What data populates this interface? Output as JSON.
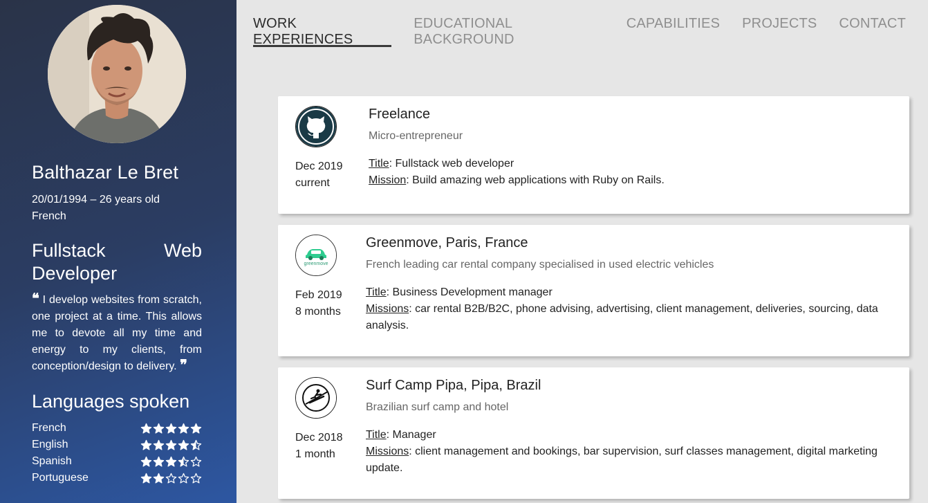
{
  "profile": {
    "name": "Balthazar Le Bret",
    "birth": "20/01/1994 – 26 years old",
    "nationality": "French",
    "role_word1": "Fullstack",
    "role_word2": "Web",
    "role_word3": "Developer",
    "quote": "I develop websites from scratch, one project at a time. This allows me to devote all my time and energy to my clients, from conception/design to delivery.",
    "quote_open": "❝",
    "quote_close": "❞"
  },
  "languages": {
    "title": "Languages spoken",
    "items": [
      {
        "name": "French",
        "rating": 5
      },
      {
        "name": "English",
        "rating": 4.5
      },
      {
        "name": "Spanish",
        "rating": 3.5
      },
      {
        "name": "Portuguese",
        "rating": 2
      }
    ]
  },
  "tabs": [
    {
      "label": "WORK EXPERIENCES",
      "active": true
    },
    {
      "label": "EDUCATIONAL BACKGROUND"
    },
    {
      "label": "CAPABILITIES"
    },
    {
      "label": "PROJECTS"
    },
    {
      "label": "CONTACT"
    }
  ],
  "experiences": [
    {
      "logo": "github-icon",
      "date_start": "Dec 2019",
      "duration": "current",
      "company": "Freelance",
      "subtitle": "Micro-entrepreneur",
      "title_label": "Title",
      "title_value": ": Fullstack web developer",
      "mission_label": "Mission",
      "mission_value": ": Build amazing web applications with Ruby on Rails."
    },
    {
      "logo": "greenmove-logo",
      "logo_text": "greenmove",
      "date_start": "Feb 2019",
      "duration": "8 months",
      "company": "Greenmove, Paris, France",
      "subtitle": "French leading car rental company specialised in used electric vehicles",
      "title_label": "Title",
      "title_value": ": Business Development manager",
      "mission_label": "Missions",
      "mission_value": ": car rental B2B/B2C, phone advising, advertising, client management, deliveries, sourcing, data analysis."
    },
    {
      "logo": "surfer-icon",
      "date_start": "Dec 2018",
      "duration": "1 month",
      "company": "Surf Camp Pipa, Pipa, Brazil",
      "subtitle": "Brazilian surf camp and hotel",
      "title_label": "Title",
      "title_value": ": Manager",
      "mission_label": "Missions",
      "mission_value": ": client management and bookings, bar supervision, surf classes management, digital marketing update."
    }
  ],
  "colors": {
    "sidebar_top": "#2a3348",
    "sidebar_bottom": "#2d57a2",
    "background": "#e6e6e6",
    "github_teal": "#1a3a46",
    "greenmove_green": "#2ecc8f"
  }
}
